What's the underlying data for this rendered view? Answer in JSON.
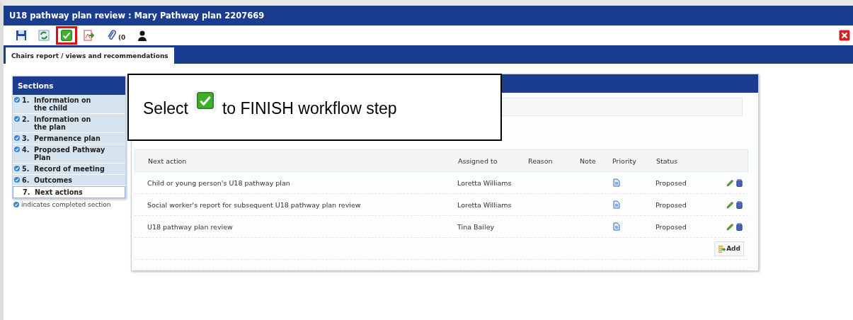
{
  "window": {
    "title": "U18 pathway plan review :  Mary Pathway plan  2207669"
  },
  "toolbar": [
    {
      "kind": "save",
      "highlighted": false
    },
    {
      "kind": "refresh",
      "highlighted": false
    },
    {
      "kind": "finish",
      "highlighted": true
    },
    {
      "kind": "export",
      "highlighted": false
    },
    {
      "kind": "attach",
      "highlighted": false,
      "count": "(0"
    },
    {
      "kind": "person",
      "highlighted": false
    }
  ],
  "tabs": [
    {
      "label": "Chairs report / views and recommendations",
      "selected": true
    }
  ],
  "sections": {
    "title": "Sections",
    "items": [
      {
        "number": "1.",
        "label": "Information on the child",
        "completed": true,
        "selected": false
      },
      {
        "number": "2.",
        "label": "Information on the plan",
        "completed": true,
        "selected": false
      },
      {
        "number": "3.",
        "label": "Permanence plan",
        "completed": true,
        "selected": false
      },
      {
        "number": "4.",
        "label": "Proposed Pathway Plan",
        "completed": true,
        "selected": false
      },
      {
        "number": "5.",
        "label": "Record of meeting",
        "completed": true,
        "selected": false
      },
      {
        "number": "6.",
        "label": "Outcomes",
        "completed": true,
        "selected": false
      },
      {
        "number": "7.",
        "label": "Next actions",
        "completed": false,
        "selected": true
      }
    ],
    "legend": "indicates completed section"
  },
  "callout": {
    "before": "Select",
    "after": "to FINISH workflow step"
  },
  "table": {
    "columns": [
      "Next action",
      "Assigned to",
      "Reason",
      "Note",
      "Priority",
      "Status"
    ],
    "rows": [
      {
        "next_action": "Child or young person's U18 pathway plan",
        "assigned_to": "Loretta Williams",
        "status": "Proposed"
      },
      {
        "next_action": "Social worker's report for subsequent U18 pathway plan review",
        "assigned_to": "Loretta Williams",
        "status": "Proposed"
      },
      {
        "next_action": "U18 pathway plan review",
        "assigned_to": "Tina Bailey",
        "status": "Proposed"
      }
    ],
    "add_button": "Add"
  }
}
